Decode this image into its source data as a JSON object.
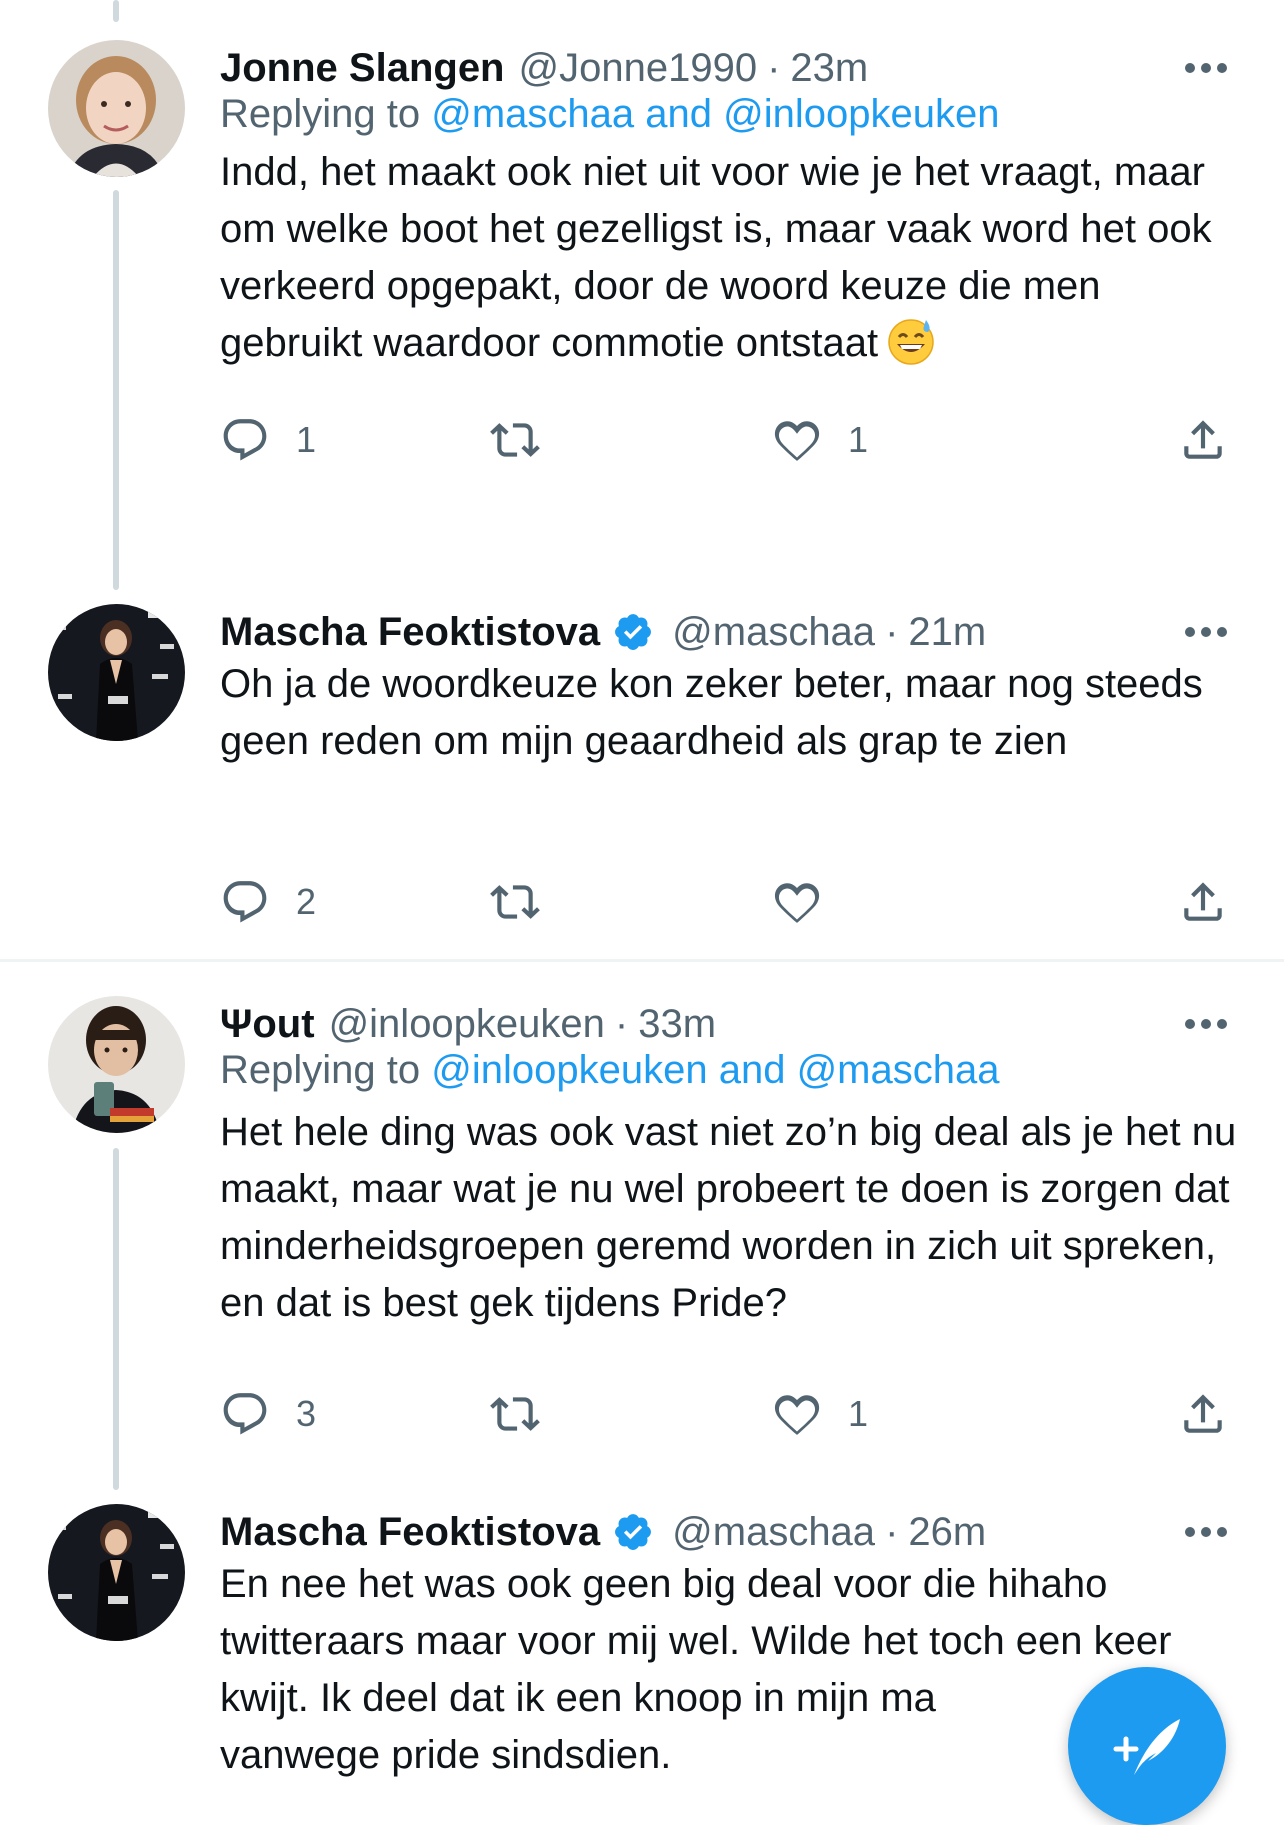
{
  "tweets": [
    {
      "name": "Jonne Slangen",
      "handle": "@Jonne1990",
      "separator": "·",
      "time": "23m",
      "verified": false,
      "reply_prefix": "Replying to",
      "reply_mentions": "@maschaa and @inloopkeuken",
      "text": "Indd, het maakt ook niet uit voor wie je het vraagt, maar om welke boot het gezelligst is, maar vaak word het ook verkeerd opgepakt, door de woord keuze die men gebruikt waardoor commotie ontstaat",
      "emoji": "grinning-face-with-sweat",
      "reply_count": "1",
      "retweet_count": "",
      "like_count": "1",
      "icons": {
        "reply": "reply-icon",
        "retweet": "retweet-icon",
        "like": "heart-icon",
        "share": "share-icon",
        "more": "more-icon"
      }
    },
    {
      "name": "Mascha Feoktistova",
      "handle": "@maschaa",
      "separator": "·",
      "time": "21m",
      "verified": true,
      "text": "Oh ja de woordkeuze kon zeker beter, maar nog steeds geen reden om mijn geaardheid als grap te zien",
      "reply_count": "2",
      "retweet_count": "",
      "like_count": ""
    },
    {
      "name": "Ψout",
      "handle": "@inloopkeuken",
      "separator": "·",
      "time": "33m",
      "verified": false,
      "reply_prefix": "Replying to",
      "reply_mentions": "@inloopkeuken and @maschaa",
      "text": "Het hele ding was ook vast niet zo’n big deal als je het nu maakt, maar wat je nu wel probeert te doen is zorgen dat minderheidsgroepen geremd worden in zich uit spreken, en dat is best gek tijdens Pride?",
      "reply_count": "3",
      "retweet_count": "",
      "like_count": "1"
    },
    {
      "name": "Mascha Feoktistova",
      "handle": "@maschaa",
      "separator": "·",
      "time": "26m",
      "verified": true,
      "text": "En nee het was ook geen big deal voor die hihaho twitteraars maar voor mij wel. Wilde het toch een keer kwijt. Ik deel dat ik een knoop in mijn ma",
      "text_tail": "vanwege pride sindsdien."
    }
  ],
  "colors": {
    "accent": "#1d9bf0",
    "secondary_text": "#536471",
    "thread_line": "#cfd9de"
  },
  "compose_button": {
    "icon": "compose-tweet-icon"
  }
}
